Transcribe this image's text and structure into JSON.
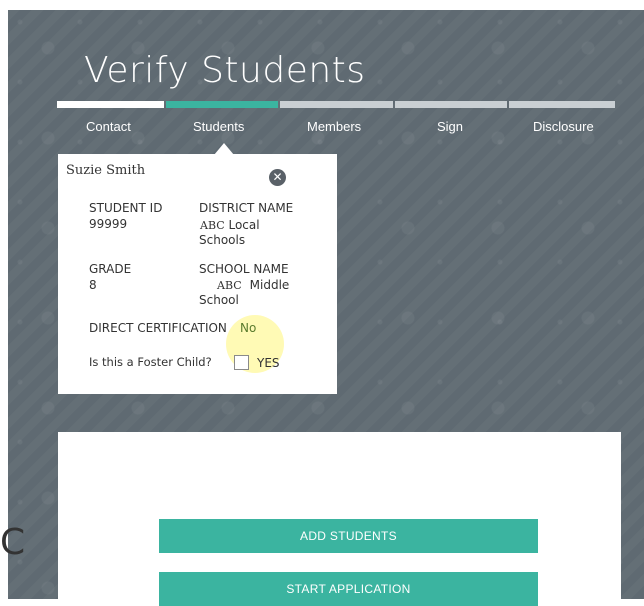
{
  "page_title": "Verify Students",
  "steps": [
    "Contact",
    "Students",
    "Members",
    "Sign",
    "Disclosure"
  ],
  "active_step": "Students",
  "student": {
    "name": "Suzie Smith",
    "close_glyph": "✕",
    "student_id_label": "STUDENT ID",
    "student_id": "99999",
    "district_label": "DISTRICT NAME",
    "district_line1_prefix": "ABC",
    "district_line1_suffix": "Local",
    "district_line2": "Schools",
    "grade_label": "GRADE",
    "grade": "8",
    "school_label": "SCHOOL NAME",
    "school_line1_prefix": "ABC",
    "school_line1_suffix": "Middle",
    "school_line2": "School",
    "direct_cert_label": "DIRECT CERTIFICATION",
    "direct_cert_value": "No",
    "foster_question": "Is this a Foster Child?",
    "foster_checkbox_label": "YES"
  },
  "actions": {
    "add_students": "ADD STUDENTS",
    "start_application": "START APPLICATION"
  },
  "edge_glyph": "C",
  "colors": {
    "accent": "#3bb4a0",
    "background": "#5f6a72",
    "direct_cert_value": "#5a7b2d"
  }
}
